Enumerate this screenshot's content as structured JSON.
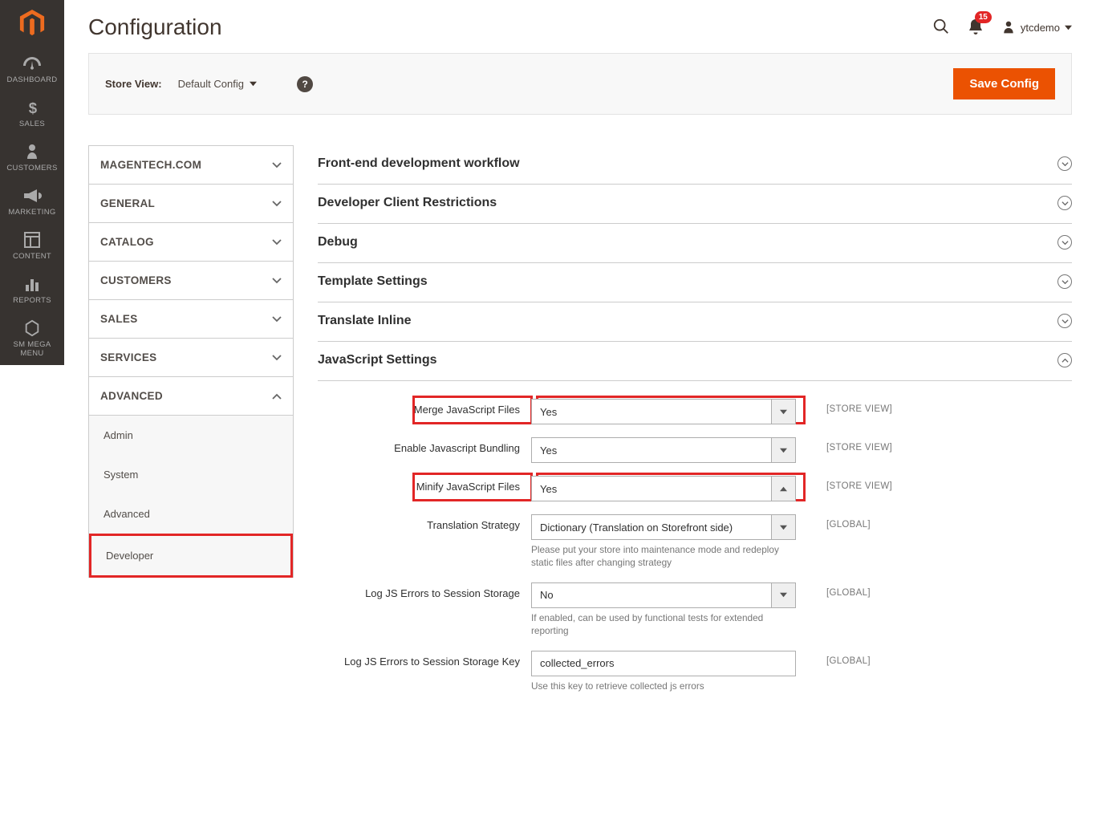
{
  "page_title": "Configuration",
  "header": {
    "notification_count": "15",
    "user_name": "ytcdemo"
  },
  "sidebar": {
    "items": [
      {
        "label": "DASHBOARD"
      },
      {
        "label": "SALES"
      },
      {
        "label": "CUSTOMERS"
      },
      {
        "label": "MARKETING"
      },
      {
        "label": "CONTENT"
      },
      {
        "label": "REPORTS"
      },
      {
        "label_line1": "SM MEGA",
        "label_line2": "MENU"
      }
    ]
  },
  "storeview": {
    "label": "Store View:",
    "value": "Default Config",
    "save_label": "Save Config"
  },
  "config_nav": {
    "tabs": [
      {
        "label": "MAGENTECH.COM"
      },
      {
        "label": "GENERAL"
      },
      {
        "label": "CATALOG"
      },
      {
        "label": "CUSTOMERS"
      },
      {
        "label": "SALES"
      },
      {
        "label": "SERVICES"
      },
      {
        "label": "ADVANCED"
      }
    ],
    "advanced_sub": [
      {
        "label": "Admin"
      },
      {
        "label": "System"
      },
      {
        "label": "Advanced"
      },
      {
        "label": "Developer"
      }
    ]
  },
  "sections": [
    {
      "title": "Front-end development workflow"
    },
    {
      "title": "Developer Client Restrictions"
    },
    {
      "title": "Debug"
    },
    {
      "title": "Template Settings"
    },
    {
      "title": "Translate Inline"
    },
    {
      "title": "JavaScript Settings"
    }
  ],
  "js_settings": {
    "merge": {
      "label": "Merge JavaScript Files",
      "value": "Yes",
      "scope": "[STORE VIEW]"
    },
    "bundle": {
      "label": "Enable Javascript Bundling",
      "value": "Yes",
      "scope": "[STORE VIEW]"
    },
    "minify": {
      "label": "Minify JavaScript Files",
      "value": "Yes",
      "scope": "[STORE VIEW]"
    },
    "trans": {
      "label": "Translation Strategy",
      "value": "Dictionary (Translation on Storefront side)",
      "scope": "[GLOBAL]",
      "note": "Please put your store into maintenance mode and redeploy static files after changing strategy"
    },
    "logerr": {
      "label": "Log JS Errors to Session Storage",
      "value": "No",
      "scope": "[GLOBAL]",
      "note": "If enabled, can be used by functional tests for extended reporting"
    },
    "logkey": {
      "label": "Log JS Errors to Session Storage Key",
      "value": "collected_errors",
      "scope": "[GLOBAL]",
      "note": "Use this key to retrieve collected js errors"
    }
  }
}
